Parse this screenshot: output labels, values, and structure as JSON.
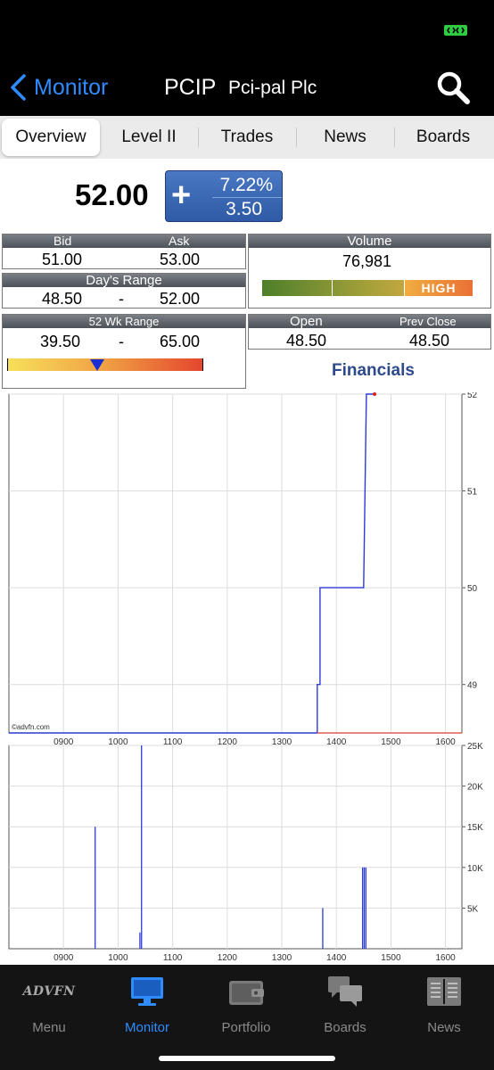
{
  "nav": {
    "back_label": "Monitor",
    "symbol": "PCIP",
    "company": "Pci-pal Plc"
  },
  "tabs": [
    {
      "label": "Overview",
      "active": true
    },
    {
      "label": "Level II",
      "active": false
    },
    {
      "label": "Trades",
      "active": false
    },
    {
      "label": "News",
      "active": false
    },
    {
      "label": "Boards",
      "active": false
    }
  ],
  "quote": {
    "price": "52.00",
    "sign": "+",
    "change_pct": "7.22%",
    "change_abs": "3.50"
  },
  "bid_ask": {
    "bid_label": "Bid",
    "ask_label": "Ask",
    "bid": "51.00",
    "ask": "53.00"
  },
  "days_range": {
    "label": "Day's Range",
    "low": "48.50",
    "sep": "-",
    "high": "52.00"
  },
  "week52": {
    "label": "52 Wk Range",
    "low": "39.50",
    "sep": "-",
    "high": "65.00",
    "position": 0.46
  },
  "volume": {
    "label": "Volume",
    "value": "76,981",
    "level": "HIGH"
  },
  "open_prev": {
    "open_label": "Open",
    "open": "48.50",
    "prev_label": "Prev Close",
    "prev": "48.50"
  },
  "financials_link": "Financials",
  "watermark": "©advfn.com",
  "chart_data": [
    {
      "type": "line",
      "x_ticks": [
        "0900",
        "1000",
        "1100",
        "1200",
        "1300",
        "1400",
        "1500",
        "1600"
      ],
      "y_ticks": [
        "49",
        "50",
        "51",
        "52"
      ],
      "xlim": [
        800,
        1630
      ],
      "ylim": [
        48.5,
        52
      ],
      "grid": true,
      "series": [
        {
          "color": "#2a3bd6",
          "points": [
            [
              800,
              48.5
            ],
            [
              1365,
              48.5
            ],
            [
              1365,
              49.0
            ],
            [
              1370,
              49.0
            ],
            [
              1370,
              50.0
            ],
            [
              1450,
              50.0
            ],
            [
              1455,
              52.0
            ],
            [
              1468,
              52.0
            ]
          ]
        },
        {
          "color": "#e05a5a",
          "points": [
            [
              1365,
              48.5
            ],
            [
              1630,
              48.5
            ]
          ]
        }
      ],
      "last_point": {
        "x": 1470,
        "y": 52.0,
        "color": "#e02020"
      }
    },
    {
      "type": "bar",
      "x_ticks": [
        "0900",
        "1000",
        "1100",
        "1200",
        "1300",
        "1400",
        "1500",
        "1600"
      ],
      "y_ticks": [
        "5K",
        "10K",
        "15K",
        "20K",
        "25K"
      ],
      "xlim": [
        800,
        1630
      ],
      "ylim": [
        0,
        25000
      ],
      "grid": true,
      "color": "#2a3bd6",
      "bars": [
        {
          "x": 958,
          "value": 15000
        },
        {
          "x": 1040,
          "value": 2000
        },
        {
          "x": 1043,
          "value": 25000
        },
        {
          "x": 1375,
          "value": 5000
        },
        {
          "x": 1448,
          "value": 10000
        },
        {
          "x": 1451,
          "value": 10000
        },
        {
          "x": 1454,
          "value": 10000
        }
      ]
    }
  ],
  "tabbar": [
    {
      "label": "Menu",
      "icon": "advfn-logo",
      "logo_text": "ADVFN",
      "active": false
    },
    {
      "label": "Monitor",
      "icon": "monitor-icon",
      "active": true
    },
    {
      "label": "Portfolio",
      "icon": "wallet-icon",
      "active": false
    },
    {
      "label": "Boards",
      "icon": "chat-bubbles-icon",
      "active": false
    },
    {
      "label": "News",
      "icon": "newspaper-icon",
      "active": false
    }
  ],
  "colors": {
    "accent": "#2f8cff",
    "change_box": "#3a67b4",
    "financials": "#2e4a8a",
    "price_line": "#2a3bd6",
    "prev_close_line": "#e05a5a"
  }
}
